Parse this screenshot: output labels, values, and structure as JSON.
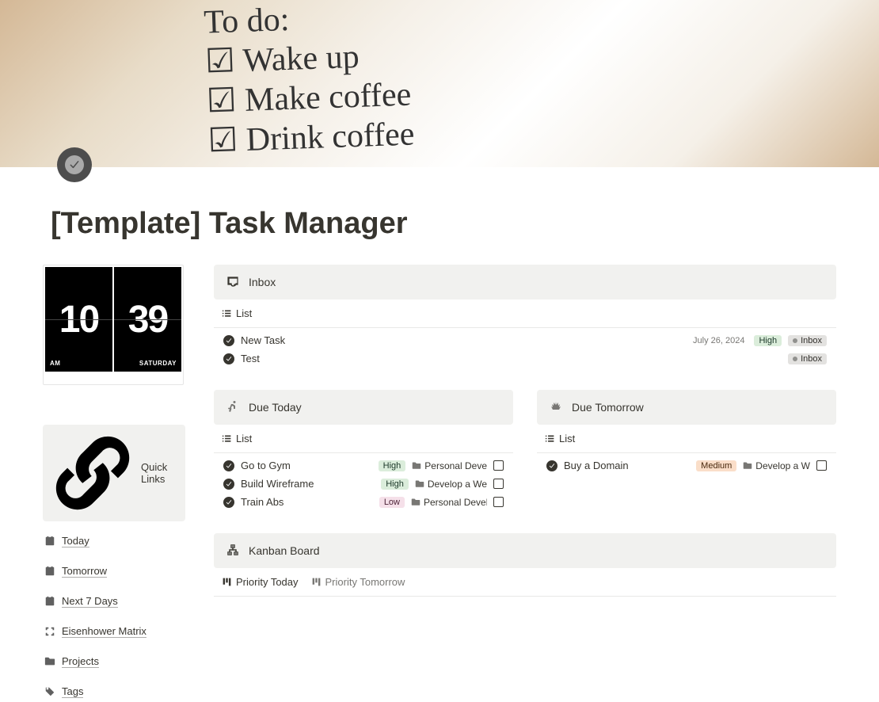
{
  "page": {
    "title": "[Template] Task Manager"
  },
  "clock": {
    "hour": "10",
    "minute": "39",
    "ampm": "AM",
    "day": "SATURDAY"
  },
  "quickLinks": {
    "title": "Quick Links",
    "items": [
      {
        "label": "Today",
        "icon": "calendar-day"
      },
      {
        "label": "Tomorrow",
        "icon": "calendar"
      },
      {
        "label": "Next 7 Days",
        "icon": "calendar-week"
      },
      {
        "label": "Eisenhower Matrix",
        "icon": "expand"
      },
      {
        "label": "Projects",
        "icon": "folder"
      },
      {
        "label": "Tags",
        "icon": "tag"
      }
    ]
  },
  "inbox": {
    "title": "Inbox",
    "viewLabel": "List",
    "tasks": [
      {
        "title": "New Task",
        "date": "July 26, 2024",
        "priority": "High",
        "bucket": "Inbox"
      },
      {
        "title": "Test",
        "bucket": "Inbox"
      }
    ]
  },
  "dueToday": {
    "title": "Due Today",
    "viewLabel": "List",
    "tasks": [
      {
        "title": "Go to Gym",
        "priority": "High",
        "project": "Personal Deve"
      },
      {
        "title": "Build Wireframe",
        "priority": "High",
        "project": "Develop a We"
      },
      {
        "title": "Train Abs",
        "priority": "Low",
        "project": "Personal Devel"
      }
    ]
  },
  "dueTomorrow": {
    "title": "Due Tomorrow",
    "viewLabel": "List",
    "tasks": [
      {
        "title": "Buy a Domain",
        "priority": "Medium",
        "project": "Develop a W"
      }
    ]
  },
  "kanban": {
    "title": "Kanban Board",
    "tabs": [
      "Priority Today",
      "Priority Tomorrow"
    ]
  }
}
